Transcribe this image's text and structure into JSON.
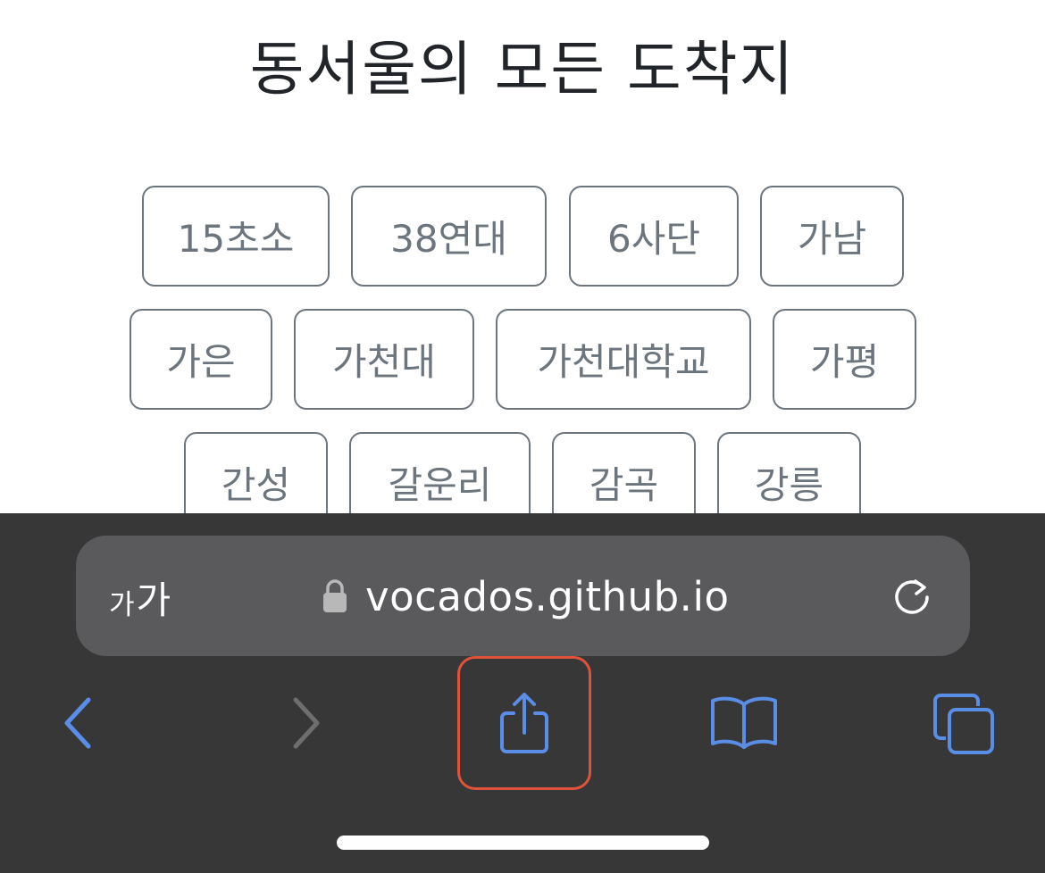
{
  "page": {
    "title": "동서울의 모든 도착지",
    "destinations": [
      "15초소",
      "38연대",
      "6사단",
      "가남",
      "가은",
      "가천대",
      "가천대학교",
      "가평",
      "간성",
      "갈운리",
      "감곡",
      "강릉"
    ]
  },
  "browser": {
    "text_size_small": "가",
    "text_size_big": "가",
    "url": "vocados.github.io",
    "icons": {
      "lock": "lock-icon",
      "reload": "reload-icon",
      "back": "chevron-left-icon",
      "forward": "chevron-right-icon",
      "share": "share-icon",
      "bookmarks": "book-icon",
      "tabs": "tabs-icon"
    },
    "colors": {
      "toolbar_bg": "#373737",
      "address_bar_bg": "#5a5a5c",
      "accent": "#5a8de6",
      "disabled": "#6e6e6e",
      "highlight": "#e0533a"
    }
  }
}
